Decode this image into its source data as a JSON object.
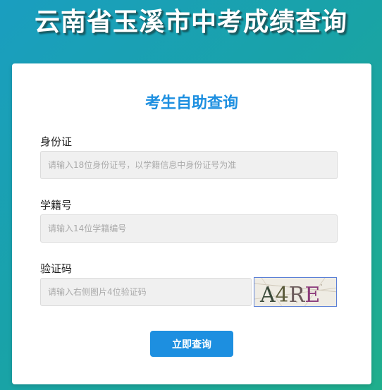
{
  "header": {
    "title": "云南省玉溪市中考成绩查询"
  },
  "card": {
    "title": "考生自助查询",
    "fields": [
      {
        "label": "身份证",
        "placeholder": "请输入18位身份证号，以学籍信息中身份证号为准"
      },
      {
        "label": "学籍号",
        "placeholder": "请输入14位学籍编号"
      },
      {
        "label": "验证码",
        "placeholder": "请输入右侧图片4位验证码"
      }
    ],
    "captcha_text": "A4RE",
    "submit_label": "立即查询"
  },
  "colors": {
    "accent": "#1d8fe0",
    "background_gradient_start": "#1a9ec0",
    "background_gradient_end": "#1fae8c"
  }
}
